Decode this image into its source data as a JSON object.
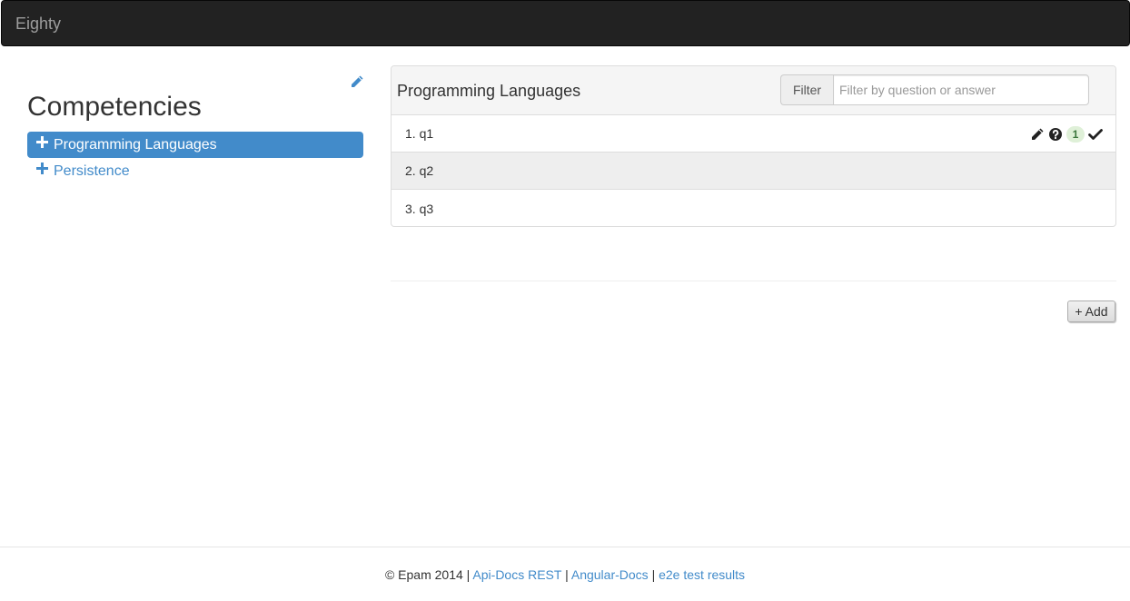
{
  "navbar": {
    "brand": "Eighty"
  },
  "sidebar": {
    "title": "Competencies",
    "edit_icon": "pencil-icon",
    "items": [
      {
        "label": "Programming Languages",
        "active": true,
        "icon": "plus-icon"
      },
      {
        "label": "Persistence",
        "active": false,
        "icon": "plus-icon"
      }
    ]
  },
  "panel": {
    "title": "Programming Languages",
    "filter_label": "Filter",
    "filter_placeholder": "Filter by question or answer",
    "filter_value": "",
    "questions": [
      {
        "label": "1. q1",
        "icons": [
          "pencil-icon",
          "question-circle-icon",
          "checkmark-icon"
        ],
        "badge": "1"
      },
      {
        "label": "2. q2",
        "hover": true
      },
      {
        "label": "3. q3"
      }
    ]
  },
  "actions": {
    "add_label": "+ Add"
  },
  "footer": {
    "copyright": "© Epam 2014",
    "separator": " | ",
    "links": [
      "Api-Docs REST",
      "Angular-Docs",
      "e2e test results"
    ]
  },
  "colors": {
    "navbar_bg": "#222222",
    "brand_text": "#9d9d9d",
    "accent": "#428bca",
    "badge_bg": "#dff0d8",
    "badge_text": "#3c763d",
    "hover_row": "#eeeeee"
  }
}
